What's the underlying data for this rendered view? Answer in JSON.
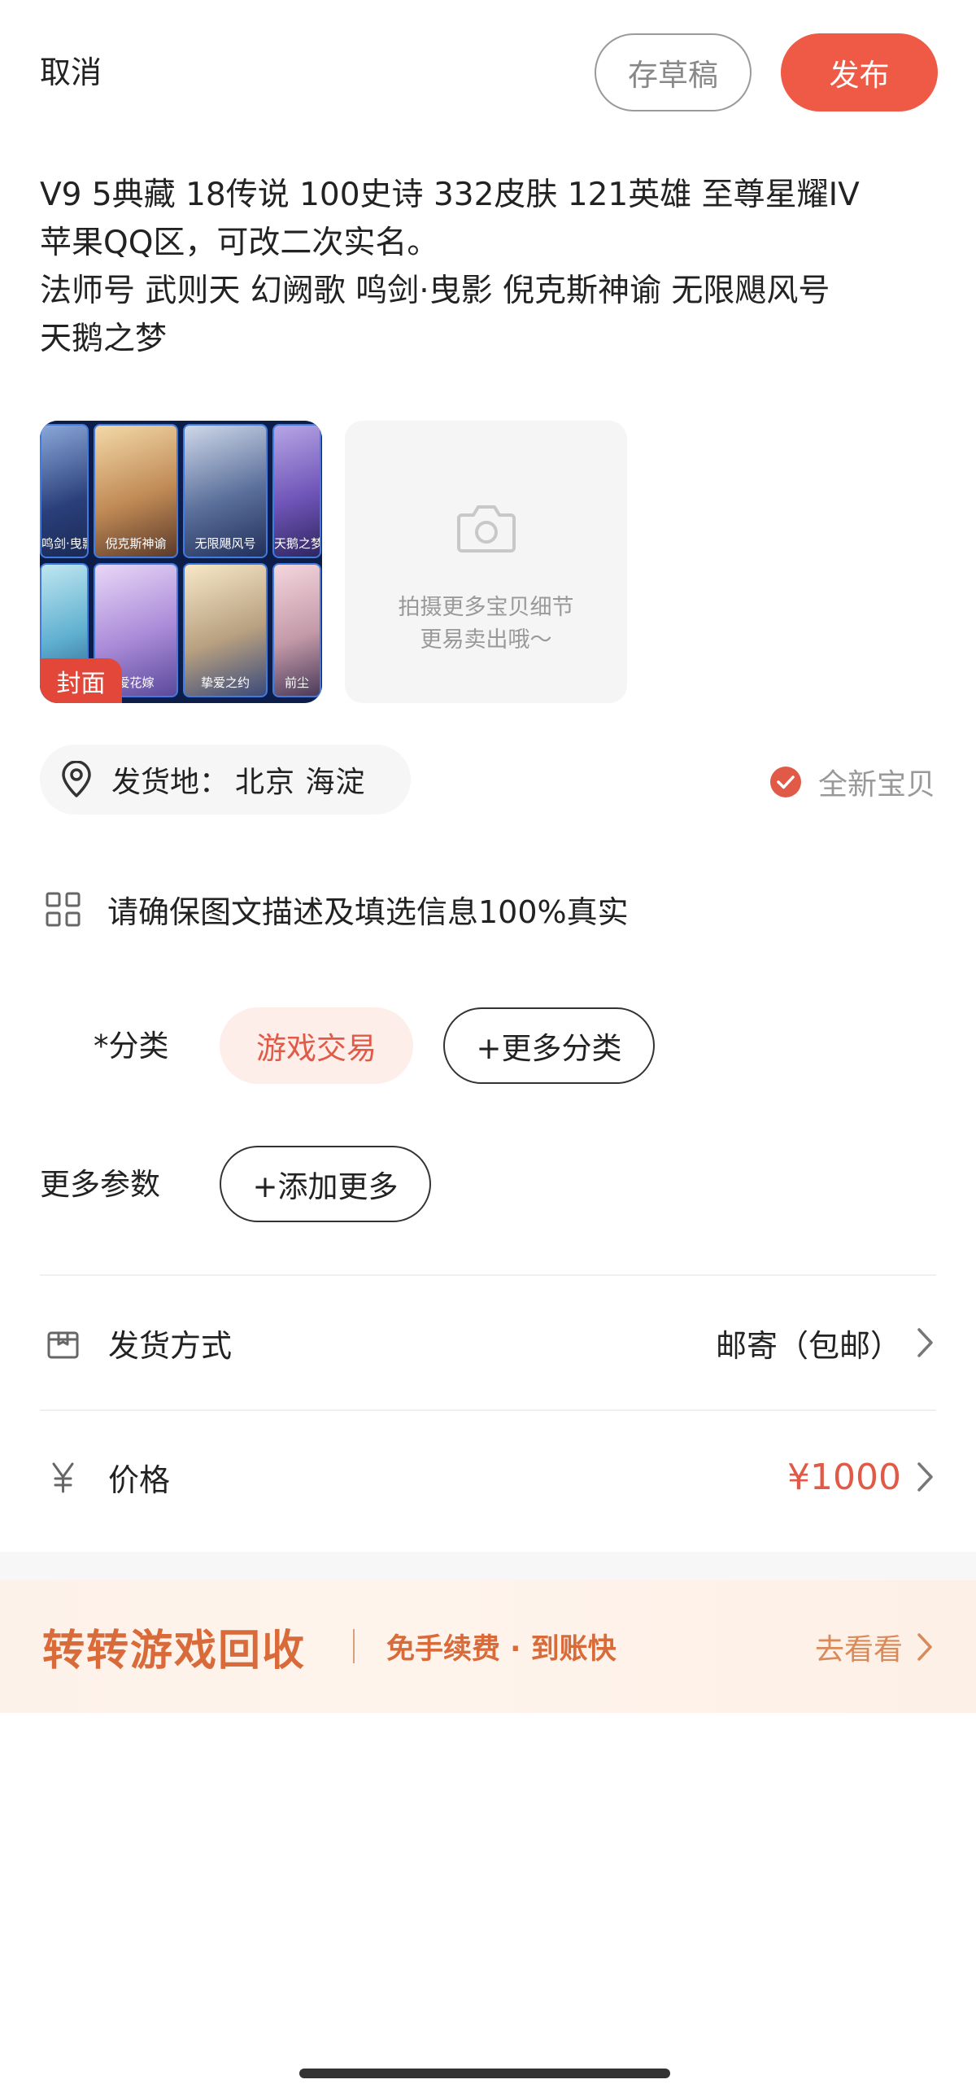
{
  "header": {
    "cancel_label": "取消",
    "draft_label": "存草稿",
    "publish_label": "发布"
  },
  "description": "V9 5典藏 18传说 100史诗 332皮肤 121英雄 至尊星耀IV\n苹果QQ区，可改二次实名。\n法师号 武则天 幻阙歌  鸣剑·曳影  倪克斯神谕 无限飓风号\n天鹅之梦",
  "photos": {
    "cover_tag": "封面",
    "tiles": [
      "鸣剑·曳影",
      "倪克斯神谕",
      "无限飓风号",
      "天鹅之梦",
      "",
      "爱花嫁",
      "挚爱之约",
      "前尘"
    ],
    "add_hint_line1": "拍摄更多宝贝细节",
    "add_hint_line2": "更易卖出哦～"
  },
  "location": {
    "label": "发货地：",
    "value": "北京  海淀"
  },
  "condition": {
    "label": "全新宝贝"
  },
  "notice": {
    "text": "请确保图文描述及填选信息100%真实"
  },
  "category": {
    "label": "*分类",
    "selected": "游戏交易",
    "more_label": "+更多分类"
  },
  "params": {
    "label": "更多参数",
    "add_label": "+添加更多"
  },
  "shipping": {
    "label": "发货方式",
    "value": "邮寄（包邮）"
  },
  "price": {
    "label": "价格",
    "value": "¥1000"
  },
  "banner": {
    "title": "转转游戏回收",
    "subtitle": "免手续费 · 到账快",
    "link": "去看看"
  },
  "colors": {
    "accent": "#ee5a45",
    "price": "#e05a47",
    "banner_text": "#d96a3a"
  }
}
